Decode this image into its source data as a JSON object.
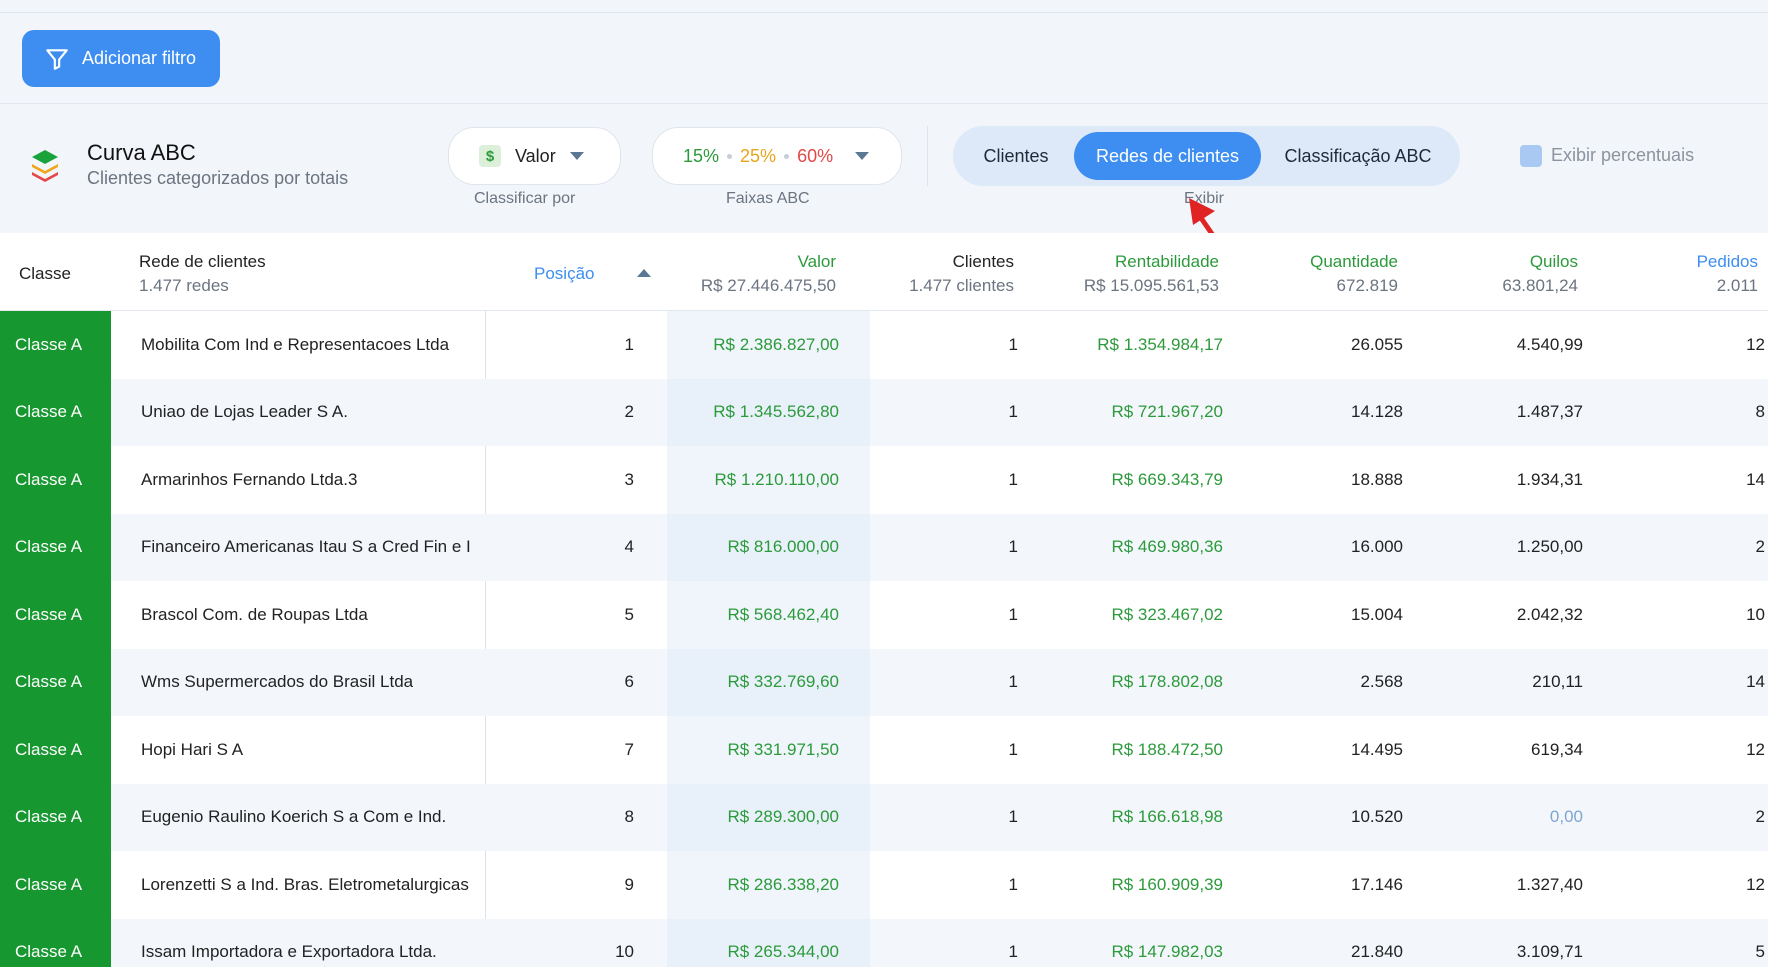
{
  "filter_button": {
    "label": "Adicionar filtro"
  },
  "header": {
    "title": "Curva ABC",
    "subtitle": "Clientes categorizados por totais"
  },
  "sort_select": {
    "value": "Valor",
    "caption": "Classificar por"
  },
  "bands_select": {
    "a": "15%",
    "b": "25%",
    "c": "60%",
    "caption": "Faixas ABC"
  },
  "view_toggle": {
    "options": [
      "Clientes",
      "Redes de clientes",
      "Classificação ABC"
    ],
    "selected": "Redes de clientes",
    "caption": "Exibir"
  },
  "show_percent": {
    "label": "Exibir percentuais",
    "checked": false
  },
  "table": {
    "columns": {
      "classe": "Classe",
      "rede": {
        "label": "Rede de clientes",
        "sub": "1.477 redes"
      },
      "posicao": "Posição",
      "valor": {
        "label": "Valor",
        "sub": "R$ 27.446.475,50"
      },
      "clientes": {
        "label": "Clientes",
        "sub": "1.477 clientes"
      },
      "rentabilidade": {
        "label": "Rentabilidade",
        "sub": "R$ 15.095.561,53"
      },
      "quantidade": {
        "label": "Quantidade",
        "sub": "672.819"
      },
      "quilos": {
        "label": "Quilos",
        "sub": "63.801,24"
      },
      "pedidos": {
        "label": "Pedidos",
        "sub": "2.011"
      }
    },
    "rows": [
      {
        "classe": "Classe A",
        "rede": "Mobilita Com Ind e Representacoes Ltda",
        "posicao": "1",
        "valor": "R$ 2.386.827,00",
        "clientes": "1",
        "rentabilidade": "R$ 1.354.984,17",
        "quantidade": "26.055",
        "quilos": "4.540,99",
        "pedidos": "12"
      },
      {
        "classe": "Classe A",
        "rede": "Uniao de Lojas Leader S A.",
        "posicao": "2",
        "valor": "R$ 1.345.562,80",
        "clientes": "1",
        "rentabilidade": "R$ 721.967,20",
        "quantidade": "14.128",
        "quilos": "1.487,37",
        "pedidos": "8"
      },
      {
        "classe": "Classe A",
        "rede": "Armarinhos Fernando Ltda.3",
        "posicao": "3",
        "valor": "R$ 1.210.110,00",
        "clientes": "1",
        "rentabilidade": "R$ 669.343,79",
        "quantidade": "18.888",
        "quilos": "1.934,31",
        "pedidos": "14"
      },
      {
        "classe": "Classe A",
        "rede": "Financeiro Americanas Itau S a Cred Fin e I",
        "posicao": "4",
        "valor": "R$ 816.000,00",
        "clientes": "1",
        "rentabilidade": "R$ 469.980,36",
        "quantidade": "16.000",
        "quilos": "1.250,00",
        "pedidos": "2"
      },
      {
        "classe": "Classe A",
        "rede": "Brascol Com. de Roupas Ltda",
        "posicao": "5",
        "valor": "R$ 568.462,40",
        "clientes": "1",
        "rentabilidade": "R$ 323.467,02",
        "quantidade": "15.004",
        "quilos": "2.042,32",
        "pedidos": "10"
      },
      {
        "classe": "Classe A",
        "rede": "Wms Supermercados do Brasil Ltda",
        "posicao": "6",
        "valor": "R$ 332.769,60",
        "clientes": "1",
        "rentabilidade": "R$ 178.802,08",
        "quantidade": "2.568",
        "quilos": "210,11",
        "pedidos": "14"
      },
      {
        "classe": "Classe A",
        "rede": "Hopi Hari S A",
        "posicao": "7",
        "valor": "R$ 331.971,50",
        "clientes": "1",
        "rentabilidade": "R$ 188.472,50",
        "quantidade": "14.495",
        "quilos": "619,34",
        "pedidos": "12"
      },
      {
        "classe": "Classe A",
        "rede": "Eugenio Raulino Koerich S a Com e Ind.",
        "posicao": "8",
        "valor": "R$ 289.300,00",
        "clientes": "1",
        "rentabilidade": "R$ 166.618,98",
        "quantidade": "10.520",
        "quilos": "0,00",
        "pedidos": "2"
      },
      {
        "classe": "Classe A",
        "rede": "Lorenzetti S a Ind. Bras. Eletrometalurgicas",
        "posicao": "9",
        "valor": "R$ 286.338,20",
        "clientes": "1",
        "rentabilidade": "R$ 160.909,39",
        "quantidade": "17.146",
        "quilos": "1.327,40",
        "pedidos": "12"
      },
      {
        "classe": "Classe A",
        "rede": "Issam Importadora e Exportadora Ltda.",
        "posicao": "10",
        "valor": "R$ 265.344,00",
        "clientes": "1",
        "rentabilidade": "R$ 147.982,03",
        "quantidade": "21.840",
        "quilos": "3.109,71",
        "pedidos": "5"
      }
    ]
  },
  "colors": {
    "accent": "#3d8ef0",
    "class_a": "#17972f",
    "positive": "#2c9a3b",
    "band_b": "#e8a51c",
    "band_c": "#e44848",
    "annotation_arrow": "#e02424"
  },
  "icons": {
    "filter": "filter-icon",
    "logo": "layers-logo-icon",
    "sort_caret": "caret-up-icon",
    "dropdown": "caret-down-icon"
  }
}
